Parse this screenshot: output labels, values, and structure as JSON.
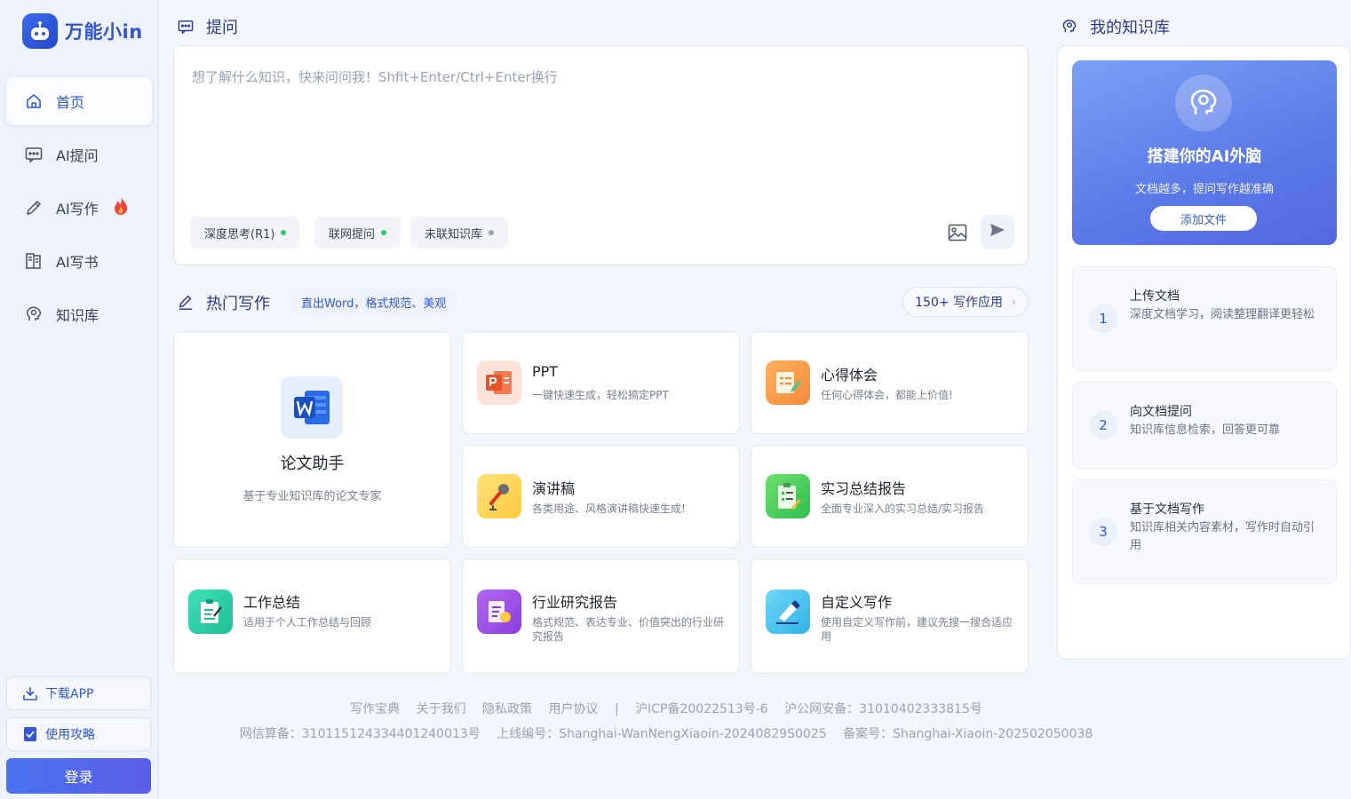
{
  "brand": {
    "name": "万能小in"
  },
  "nav": {
    "items": [
      {
        "label": "首页",
        "icon": "home-icon",
        "active": true
      },
      {
        "label": "AI提问",
        "icon": "chat-icon"
      },
      {
        "label": "AI写作",
        "icon": "pen-icon",
        "badge": "fire-icon"
      },
      {
        "label": "AI写书",
        "icon": "book-icon"
      },
      {
        "label": "知识库",
        "icon": "brain-icon"
      }
    ],
    "download": "下载APP",
    "guide": "使用攻略",
    "login": "登录"
  },
  "ask": {
    "title": "提问",
    "placeholder": "想了解什么知识，快来问问我！Shfit+Enter/Ctrl+Enter换行",
    "chips": [
      {
        "label": "深度思考(R1)",
        "status": "green"
      },
      {
        "label": "联网提问",
        "status": "green"
      },
      {
        "label": "未联知识库",
        "status": "gray"
      }
    ]
  },
  "hot": {
    "title": "热门写作",
    "subtitle": "直出Word，格式规范、美观",
    "more": "150+ 写作应用",
    "featured": {
      "title": "论文助手",
      "desc": "基于专业知识库的论文专家",
      "icon": "word-icon"
    },
    "cards": [
      {
        "title": "PPT",
        "desc": "一键快速生成，轻松搞定PPT",
        "icon": "ppt-icon"
      },
      {
        "title": "心得体会",
        "desc": "任何心得体会，都能上价值!",
        "icon": "notes-icon"
      },
      {
        "title": "演讲稿",
        "desc": "各类用途、风格演讲稿快速生成!",
        "icon": "microphone-icon"
      },
      {
        "title": "实习总结报告",
        "desc": "全面专业深入的实习总结/实习报告",
        "icon": "clipboard-icon"
      },
      {
        "title": "工作总结",
        "desc": "适用于个人工作总结与回顾",
        "icon": "summary-icon"
      },
      {
        "title": "行业研究报告",
        "desc": "格式规范、表达专业、价值突出的行业研究报告",
        "icon": "report-icon"
      },
      {
        "title": "自定义写作",
        "desc": "使用自定义写作前，建议先搜一搜合适应用",
        "icon": "custom-pen-icon"
      }
    ]
  },
  "footer": {
    "links": [
      "写作宝典",
      "关于我们",
      "隐私政策",
      "用户协议"
    ],
    "separator": "|",
    "icp": "沪ICP备20022513号-6",
    "police": "沪公网安备：31010402333815号",
    "line2": [
      "网信算备：310115124334401240013号",
      "上线编号：Shanghai-WanNengXiaoin-20240829S0025",
      "备案号：Shanghai-Xiaoin-202502050038"
    ]
  },
  "kb": {
    "title": "我的知识库",
    "banner_title": "搭建你的AI外脑",
    "banner_sub": "文档越多，提问写作越准确",
    "add_file": "添加文件",
    "steps": [
      {
        "num": "1",
        "title": "上传文档",
        "desc": "深度文档学习，阅读整理翻译更轻松"
      },
      {
        "num": "2",
        "title": "向文档提问",
        "desc": "知识库信息检索，回答更可靠"
      },
      {
        "num": "3",
        "title": "基于文档写作",
        "desc": "知识库相关内容素材，写作时自动引用"
      }
    ]
  },
  "colors": {
    "accent": "#3458d8",
    "green_dot": "#2ecc71",
    "gray_dot": "#9aa1b1"
  }
}
